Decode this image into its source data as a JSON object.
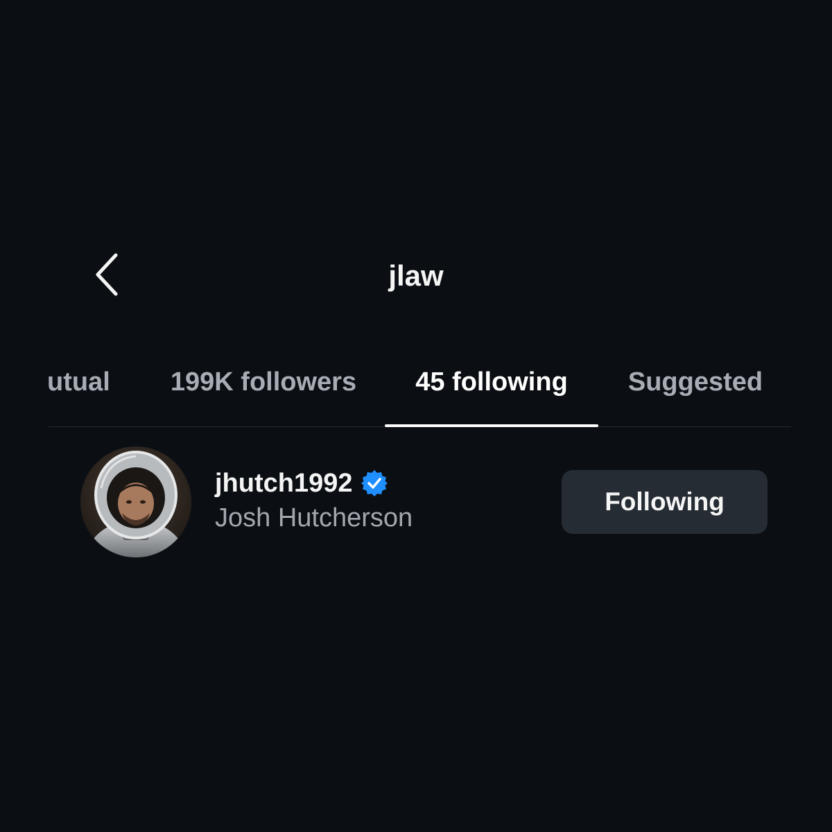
{
  "header": {
    "title": "jlaw",
    "back_icon": "chevron-left-icon"
  },
  "tabs": [
    {
      "label": "utual",
      "active": false
    },
    {
      "label": "199K followers",
      "active": false
    },
    {
      "label": "45 following",
      "active": true
    },
    {
      "label": "Suggested",
      "active": false
    }
  ],
  "list": {
    "items": [
      {
        "username": "jhutch1992",
        "display_name": "Josh Hutcherson",
        "verified": true,
        "verified_icon": "verified-badge-icon",
        "button_label": "Following"
      }
    ]
  },
  "colors": {
    "background": "#0b0f14",
    "verified_blue": "#1f8fff",
    "button_bg": "#262c34",
    "muted_text": "#a8adb5"
  }
}
